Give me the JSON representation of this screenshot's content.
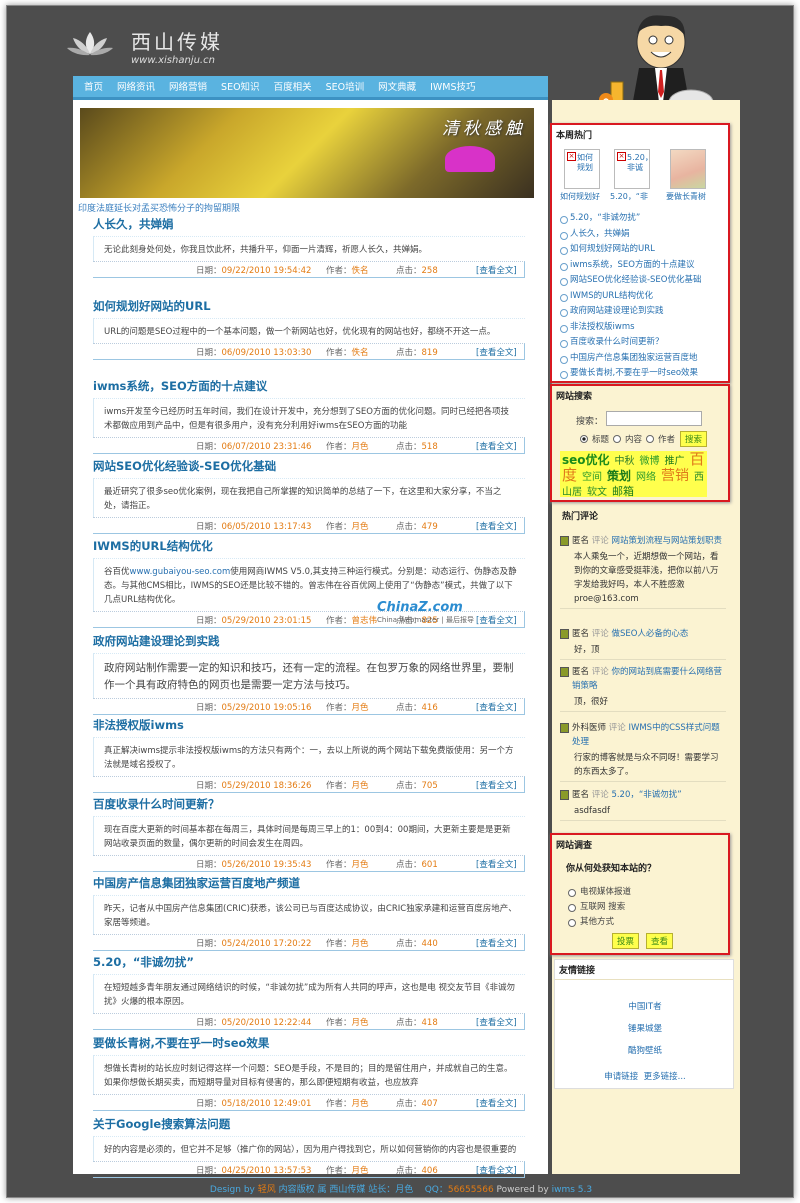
{
  "site": {
    "name": "西山传媒",
    "url": "www.xishanju.cn"
  },
  "nav": [
    "首页",
    "网络资讯",
    "网络营销",
    "SEO知识",
    "百度相关",
    "SEO培训",
    "网文典藏",
    "IWMS技巧"
  ],
  "banner": {
    "title": "清秋感触",
    "caption": "印度法庭延长对孟买恐怖分子的拘留期限"
  },
  "meta_labels": {
    "date": "日期：",
    "author": "作者：",
    "hits": "点击：",
    "more": "[查看全文]"
  },
  "articles": [
    {
      "title": "人长久，共婵娟",
      "summary": "无论此刻身处何处，你我且饮此杯，共播升平，仰面一片清辉，祈愿人长久，共婵娟。",
      "date": "09/22/2010 19:54:42",
      "author": "佚名",
      "hits": "258"
    },
    {
      "title": "如何规划好网站的URL",
      "summary": "URL的问题是SEO过程中的一个基本问题，做一个新网站也好，优化现有的网站也好，都绕不开这一点。",
      "date": "06/09/2010 13:03:30",
      "author": "佚名",
      "hits": "819"
    },
    {
      "title": "iwms系统，SEO方面的十点建议",
      "summary": "iwms开发至今已经历时五年时间，我们在设计开发中，充分想到了SEO方面的优化问题。同时已经把各项技术都做应用到产品中，但是有很多用户，没有充分利用好iwms在SEO方面的功能",
      "date": "06/07/2010 23:31:46",
      "author": "月色",
      "hits": "518"
    },
    {
      "title": "网站SEO优化经验谈-SEO优化基础",
      "summary": "最近研究了很多seo优化案例，现在我把自己所掌握的知识简单的总结了一下，在这里和大家分享，不当之处，请指正。",
      "date": "06/05/2010 13:17:43",
      "author": "月色",
      "hits": "479"
    },
    {
      "title": "IWMS的URL结构优化",
      "summary_link": "www.gubaiyou-seo.com",
      "summary_pre": "谷百优",
      "summary": "使用网商IWMS V5.0,其支持三种运行模式。分别是：动态运行、伪静态及静态。与其他CMS相比，IWMS的SEO还是比较不错的。曾志伟在谷百优网上使用了“伪静态”模式，共做了以下几点URL结构优化。",
      "date": "05/29/2010 23:01:15",
      "author": "曾志伟",
      "hits": "825"
    },
    {
      "title": "政府网站建设理论到实践",
      "summary": "政府网站制作需要一定的知识和技巧，还有一定的流程。在包罗万象的网络世界里，要制作一个具有政府特色的网页也是需要一定方法与技巧。",
      "date": "05/29/2010 19:05:16",
      "author": "月色",
      "hits": "416"
    },
    {
      "title": "非法授权版iwms",
      "summary": "真正解决iwms提示非法授权版iwms的方法只有两个：一，去以上所说的两个网站下载免费版使用：另一个方法就是域名授权了。",
      "date": "05/29/2010 18:36:26",
      "author": "月色",
      "hits": "705"
    },
    {
      "title": "百度收录什么时间更新？",
      "summary": "现在百度大更新的时间基本都在每周三，具体时间是每周三早上的1：00到4：00期间，大更新主要是是更新网站收录页面的数量，偶尔更新的时间会发生在周四。",
      "date": "05/26/2010 19:35:43",
      "author": "月色",
      "hits": "601"
    },
    {
      "title": "中国房产信息集团独家运营百度地产频道",
      "summary": "昨天，记者从中国房产信息集团(CRIC)获悉，该公司已与百度达成协议，由CRIC独家承建和运营百度房地产、家居等频道。",
      "date": "05/24/2010 17:20:22",
      "author": "月色",
      "hits": "440"
    },
    {
      "title": "5.20，“非诚勿扰”",
      "summary": "在短短越多青年朋友通过网络结识的时候，“非诚勿扰”成为所有人共同的呼声，这也是电 视交友节目《非诚勿扰》火爆的根本原因。",
      "date": "05/20/2010 12:22:44",
      "author": "月色",
      "hits": "418"
    },
    {
      "title": "要做长青树,不要在乎一时seo效果",
      "summary": "想做长青树的站长应时刻记得这样一个问题：SEO是手段，不是目的；目的是留住用户，并成就自己的生意。如果你想做长期买卖，而短期导量对目标有侵害的，那么即便短期有收益，也应放弃",
      "date": "05/18/2010 12:49:01",
      "author": "月色",
      "hits": "407"
    },
    {
      "title": "关于Google搜索算法问题",
      "summary": "好的内容是必须的，但它并不足够（推广你的网站），因为用户得找到它，所以如何营销你的内容也是很重要的",
      "date": "04/25/2010 13:57:53",
      "author": "月色",
      "hits": "406"
    }
  ],
  "watermark": {
    "brand": "ChinaZ.com",
    "sub": "China Webmaster | 最后报导"
  },
  "hot": {
    "title": "本周热门",
    "thumbs": [
      {
        "img_text": "如何规划",
        "caption": "如何规划好"
      },
      {
        "img_text": "5.20，非诚",
        "caption": "5.20，“非"
      },
      {
        "img_text": "",
        "caption": "要做长青树"
      }
    ],
    "items": [
      "5.20，“非诚勿扰”",
      "人长久，共婵娟",
      "如何规划好网站的URL",
      "iwms系统，SEO方面的十点建议",
      "网站SEO优化经验谈-SEO优化基础",
      "IWMS的URL结构优化",
      "政府网站建设理论到实践",
      "非法授权版iwms",
      "百度收录什么时间更新？",
      "中国房产信息集团独家运营百度地",
      "要做长青树,不要在乎一时seo效果"
    ]
  },
  "search": {
    "title": "网站搜索",
    "label": "搜索：",
    "options": [
      "标题",
      "内容",
      "作者"
    ],
    "button": "搜索",
    "tags": [
      {
        "text": "seo优化",
        "color": "#1a8a1a"
      },
      {
        "text": "中秋",
        "color": "#2a7a2a"
      },
      {
        "text": "微博",
        "color": "#2a9a2a"
      },
      {
        "text": "推广",
        "color": "#1a7a1a"
      },
      {
        "text": "百度",
        "color": "#e07a1a"
      },
      {
        "text": "空间",
        "color": "#2a9a2a"
      },
      {
        "text": "策划",
        "color": "#1a7a1a"
      },
      {
        "text": "网络",
        "color": "#2a9a2a"
      },
      {
        "text": "营销",
        "color": "#e07a1a"
      },
      {
        "text": "西山居",
        "color": "#2a8a2a"
      },
      {
        "text": "软文",
        "color": "#2a8a2a"
      },
      {
        "text": "邮箱",
        "color": "#1a7a1a"
      }
    ]
  },
  "comments": {
    "title": "热门评论",
    "items": [
      {
        "who": "匿名",
        "verb": "评论",
        "target": "网站策划流程与网站策划职责",
        "text": "本人乘兔一个，近期想做一个网站，看到你的文章感受挺菲浅，把你以前八万字发给我好吗，本人不胜感激 proe@163.com"
      },
      {
        "who": "匿名",
        "verb": "评论",
        "target": "做SEO人必备的心态",
        "text": "好，顶"
      },
      {
        "who": "匿名",
        "verb": "评论",
        "target": "你的网站到底需要什么网络营销策略",
        "text": "顶，很好"
      },
      {
        "who": "外科医师",
        "verb": "评论",
        "target": "IWMS中的CSS样式问题处理",
        "text": "行家的博客就是与众不同呀！需要学习的东西太多了。"
      },
      {
        "who": "匿名",
        "verb": "评论",
        "target": "5.20，“非诚勿扰”",
        "text": "asdfasdf"
      }
    ]
  },
  "survey": {
    "title": "网站调查",
    "question": "你从何处获知本站的？",
    "options": [
      "电视媒体报道",
      "互联网 搜索",
      "其他方式"
    ],
    "vote": "投票",
    "view": "查看"
  },
  "links": {
    "title": "友情链接",
    "items": [
      "中国IT者",
      "锤果城堡",
      "酷狗壁纸"
    ],
    "apply": "申请链接",
    "more": "更多链接..."
  },
  "footer": {
    "design": "Design by",
    "designer": "轻风",
    "copyright": "内容版权 属 西山传媒 站长：月色",
    "qq_label": "QQ：",
    "qq": "56655566",
    "powered": "Powered by",
    "engine": "iwms 5.3"
  }
}
